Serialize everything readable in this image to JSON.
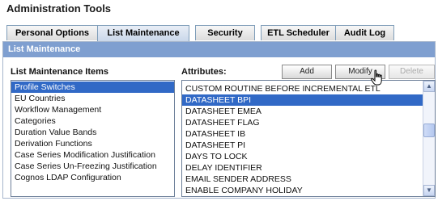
{
  "page": {
    "title": "Administration Tools"
  },
  "tabs": [
    {
      "label": "Personal Options",
      "active": false
    },
    {
      "label": "List Maintenance",
      "active": true
    },
    {
      "label": "Security",
      "active": false
    },
    {
      "label": "ETL Scheduler",
      "active": false
    },
    {
      "label": "Audit Log",
      "active": false
    }
  ],
  "panel": {
    "header": "List Maintenance"
  },
  "left_list": {
    "label": "List Maintenance Items",
    "items": [
      "Profile Switches",
      "EU Countries",
      "Workflow Management",
      "Categories",
      "Duration Value Bands",
      "Derivation Functions",
      "Case Series Modification Justification",
      "Case Series Un-Freezing Justification",
      "Cognos LDAP Configuration"
    ],
    "selected": "Profile Switches"
  },
  "attributes": {
    "label": "Attributes:",
    "items": [
      "CUSTOM ROUTINE BEFORE INCREMENTAL ETL",
      "DATASHEET BPI",
      "DATASHEET EMEA",
      "DATASHEET FLAG",
      "DATASHEET IB",
      "DATASHEET PI",
      "DAYS TO LOCK",
      "DELAY IDENTIFIER",
      "EMAIL SENDER ADDRESS",
      "ENABLE COMPANY HOLIDAY"
    ],
    "selected": "DATASHEET BPI"
  },
  "buttons": {
    "add": "Add",
    "modify": "Modify",
    "delete": "Delete"
  },
  "icons": {
    "scroll_up": "chevron-up-icon",
    "scroll_down": "chevron-down-icon",
    "cursor": "hand-pointer-icon"
  },
  "colors": {
    "header_bg": "#7f9fd0",
    "selection": "#3169c6"
  }
}
